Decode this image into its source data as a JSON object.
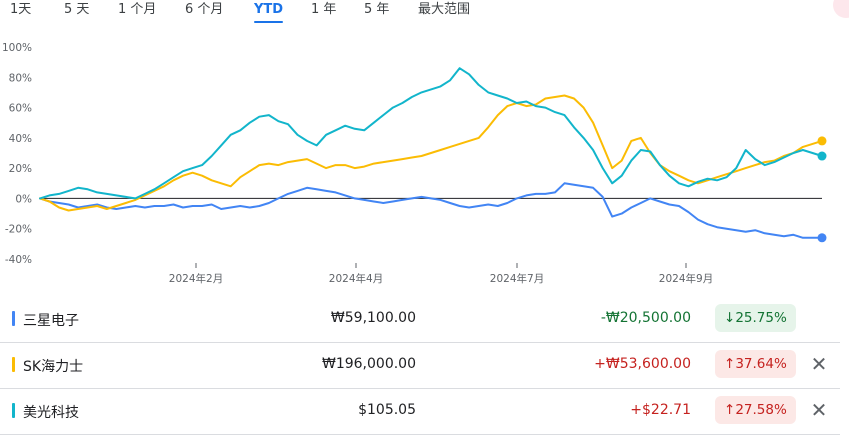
{
  "tabs": [
    {
      "label": "1天",
      "active": false
    },
    {
      "label": "5 天",
      "active": false
    },
    {
      "label": "1 个月",
      "active": false
    },
    {
      "label": "6 个月",
      "active": false
    },
    {
      "label": "YTD",
      "active": true
    },
    {
      "label": "1 年",
      "active": false
    },
    {
      "label": "5 年",
      "active": false
    },
    {
      "label": "最大范围",
      "active": false
    }
  ],
  "chart_data": {
    "type": "line",
    "ylim": [
      -40,
      100
    ],
    "yticks": [
      "100%",
      "80%",
      "60%",
      "40%",
      "20%",
      "0%",
      "-20%",
      "-40%"
    ],
    "xtick_labels": [
      "2024年2月",
      "2024年4月",
      "2024年7月",
      "2024年9月"
    ],
    "grid": false,
    "zero_line": true,
    "series": [
      {
        "name": "三星电子",
        "color": "#4285f4",
        "values": [
          [
            0,
            0
          ],
          [
            4,
            -2
          ],
          [
            8,
            -3
          ],
          [
            12,
            -4
          ],
          [
            16,
            -6
          ],
          [
            20,
            -5
          ],
          [
            24,
            -4
          ],
          [
            28,
            -6
          ],
          [
            32,
            -7
          ],
          [
            36,
            -6
          ],
          [
            40,
            -5
          ],
          [
            44,
            -6
          ],
          [
            48,
            -5
          ],
          [
            52,
            -5
          ],
          [
            56,
            -4
          ],
          [
            60,
            -6
          ],
          [
            64,
            -5
          ],
          [
            68,
            -5
          ],
          [
            72,
            -4
          ],
          [
            76,
            -7
          ],
          [
            80,
            -6
          ],
          [
            84,
            -5
          ],
          [
            88,
            -6
          ],
          [
            92,
            -5
          ],
          [
            96,
            -3
          ],
          [
            100,
            0
          ],
          [
            104,
            3
          ],
          [
            108,
            5
          ],
          [
            112,
            7
          ],
          [
            116,
            6
          ],
          [
            120,
            5
          ],
          [
            124,
            4
          ],
          [
            128,
            2
          ],
          [
            132,
            0
          ],
          [
            136,
            -1
          ],
          [
            140,
            -2
          ],
          [
            144,
            -3
          ],
          [
            148,
            -2
          ],
          [
            152,
            -1
          ],
          [
            156,
            0
          ],
          [
            160,
            1
          ],
          [
            164,
            0
          ],
          [
            168,
            -1
          ],
          [
            172,
            -3
          ],
          [
            176,
            -5
          ],
          [
            180,
            -6
          ],
          [
            184,
            -5
          ],
          [
            188,
            -4
          ],
          [
            192,
            -5
          ],
          [
            196,
            -3
          ],
          [
            200,
            0
          ],
          [
            204,
            2
          ],
          [
            208,
            3
          ],
          [
            212,
            3
          ],
          [
            216,
            4
          ],
          [
            220,
            10
          ],
          [
            224,
            9
          ],
          [
            228,
            8
          ],
          [
            232,
            7
          ],
          [
            236,
            1
          ],
          [
            240,
            -12
          ],
          [
            244,
            -10
          ],
          [
            248,
            -6
          ],
          [
            252,
            -3
          ],
          [
            256,
            0
          ],
          [
            260,
            -2
          ],
          [
            264,
            -4
          ],
          [
            268,
            -5
          ],
          [
            272,
            -9
          ],
          [
            276,
            -14
          ],
          [
            280,
            -17
          ],
          [
            284,
            -19
          ],
          [
            288,
            -20
          ],
          [
            292,
            -21
          ],
          [
            296,
            -22
          ],
          [
            300,
            -21
          ],
          [
            304,
            -23
          ],
          [
            308,
            -24
          ],
          [
            312,
            -25
          ],
          [
            316,
            -24
          ],
          [
            320,
            -26
          ],
          [
            324,
            -26
          ],
          [
            328,
            -26
          ]
        ]
      },
      {
        "name": "SK海力士",
        "color": "#fbbc04",
        "values": [
          [
            0,
            0
          ],
          [
            4,
            -2
          ],
          [
            8,
            -6
          ],
          [
            12,
            -8
          ],
          [
            16,
            -7
          ],
          [
            20,
            -6
          ],
          [
            24,
            -5
          ],
          [
            28,
            -7
          ],
          [
            32,
            -5
          ],
          [
            36,
            -3
          ],
          [
            40,
            -1
          ],
          [
            44,
            2
          ],
          [
            48,
            5
          ],
          [
            52,
            8
          ],
          [
            56,
            12
          ],
          [
            60,
            15
          ],
          [
            64,
            17
          ],
          [
            68,
            15
          ],
          [
            72,
            12
          ],
          [
            76,
            10
          ],
          [
            80,
            8
          ],
          [
            84,
            14
          ],
          [
            88,
            18
          ],
          [
            92,
            22
          ],
          [
            96,
            23
          ],
          [
            100,
            22
          ],
          [
            104,
            24
          ],
          [
            108,
            25
          ],
          [
            112,
            26
          ],
          [
            116,
            23
          ],
          [
            120,
            20
          ],
          [
            124,
            22
          ],
          [
            128,
            22
          ],
          [
            132,
            20
          ],
          [
            136,
            21
          ],
          [
            140,
            23
          ],
          [
            144,
            24
          ],
          [
            148,
            25
          ],
          [
            152,
            26
          ],
          [
            156,
            27
          ],
          [
            160,
            28
          ],
          [
            164,
            30
          ],
          [
            168,
            32
          ],
          [
            172,
            34
          ],
          [
            176,
            36
          ],
          [
            180,
            38
          ],
          [
            184,
            40
          ],
          [
            188,
            47
          ],
          [
            192,
            55
          ],
          [
            196,
            61
          ],
          [
            200,
            63
          ],
          [
            204,
            61
          ],
          [
            208,
            62
          ],
          [
            212,
            66
          ],
          [
            216,
            67
          ],
          [
            220,
            68
          ],
          [
            224,
            66
          ],
          [
            228,
            60
          ],
          [
            232,
            50
          ],
          [
            236,
            35
          ],
          [
            240,
            20
          ],
          [
            244,
            25
          ],
          [
            248,
            38
          ],
          [
            252,
            40
          ],
          [
            256,
            30
          ],
          [
            260,
            22
          ],
          [
            264,
            18
          ],
          [
            268,
            15
          ],
          [
            272,
            12
          ],
          [
            276,
            10
          ],
          [
            280,
            12
          ],
          [
            284,
            14
          ],
          [
            288,
            16
          ],
          [
            292,
            18
          ],
          [
            296,
            20
          ],
          [
            300,
            22
          ],
          [
            304,
            24
          ],
          [
            308,
            25
          ],
          [
            312,
            28
          ],
          [
            316,
            30
          ],
          [
            320,
            34
          ],
          [
            324,
            36
          ],
          [
            328,
            38
          ]
        ]
      },
      {
        "name": "美光科技",
        "color": "#12b5cb",
        "values": [
          [
            0,
            0
          ],
          [
            4,
            2
          ],
          [
            8,
            3
          ],
          [
            12,
            5
          ],
          [
            16,
            7
          ],
          [
            20,
            6
          ],
          [
            24,
            4
          ],
          [
            28,
            3
          ],
          [
            32,
            2
          ],
          [
            36,
            1
          ],
          [
            40,
            0
          ],
          [
            44,
            3
          ],
          [
            48,
            6
          ],
          [
            52,
            10
          ],
          [
            56,
            14
          ],
          [
            60,
            18
          ],
          [
            64,
            20
          ],
          [
            68,
            22
          ],
          [
            72,
            28
          ],
          [
            76,
            35
          ],
          [
            80,
            42
          ],
          [
            84,
            45
          ],
          [
            88,
            50
          ],
          [
            92,
            54
          ],
          [
            96,
            55
          ],
          [
            100,
            51
          ],
          [
            104,
            49
          ],
          [
            108,
            42
          ],
          [
            112,
            38
          ],
          [
            116,
            35
          ],
          [
            120,
            42
          ],
          [
            124,
            45
          ],
          [
            128,
            48
          ],
          [
            132,
            46
          ],
          [
            136,
            45
          ],
          [
            140,
            50
          ],
          [
            144,
            55
          ],
          [
            148,
            60
          ],
          [
            152,
            63
          ],
          [
            156,
            67
          ],
          [
            160,
            70
          ],
          [
            164,
            72
          ],
          [
            168,
            74
          ],
          [
            172,
            78
          ],
          [
            176,
            86
          ],
          [
            180,
            82
          ],
          [
            184,
            75
          ],
          [
            188,
            70
          ],
          [
            192,
            68
          ],
          [
            196,
            66
          ],
          [
            200,
            63
          ],
          [
            204,
            64
          ],
          [
            208,
            61
          ],
          [
            212,
            60
          ],
          [
            216,
            57
          ],
          [
            220,
            55
          ],
          [
            224,
            47
          ],
          [
            228,
            40
          ],
          [
            232,
            32
          ],
          [
            236,
            20
          ],
          [
            240,
            10
          ],
          [
            244,
            15
          ],
          [
            248,
            25
          ],
          [
            252,
            32
          ],
          [
            256,
            31
          ],
          [
            260,
            22
          ],
          [
            264,
            15
          ],
          [
            268,
            10
          ],
          [
            272,
            8
          ],
          [
            276,
            11
          ],
          [
            280,
            13
          ],
          [
            284,
            12
          ],
          [
            288,
            14
          ],
          [
            292,
            20
          ],
          [
            296,
            32
          ],
          [
            300,
            26
          ],
          [
            304,
            22
          ],
          [
            308,
            24
          ],
          [
            312,
            27
          ],
          [
            316,
            30
          ],
          [
            320,
            32
          ],
          [
            324,
            30
          ],
          [
            328,
            28
          ]
        ]
      }
    ]
  },
  "rows": [
    {
      "name": "三星电子",
      "color": "#4285f4",
      "price": "₩59,100.00",
      "change": "-₩20,500.00",
      "pct": "25.75%",
      "arrow": "↓",
      "dir": "down",
      "closable": false
    },
    {
      "name": "SK海力士",
      "color": "#fbbc04",
      "price": "₩196,000.00",
      "change": "+₩53,600.00",
      "pct": "37.64%",
      "arrow": "↑",
      "dir": "up",
      "closable": true
    },
    {
      "name": "美光科技",
      "color": "#12b5cb",
      "price": "$105.05",
      "change": "+$22.71",
      "pct": "27.58%",
      "arrow": "↑",
      "dir": "up",
      "closable": true
    }
  ],
  "close_glyph": "✕",
  "colors": {
    "up_text": "#c5221f",
    "up_bg": "#fce8e6",
    "down_text": "#137333",
    "down_bg": "#e6f4ea",
    "accent": "#1a73e8"
  }
}
